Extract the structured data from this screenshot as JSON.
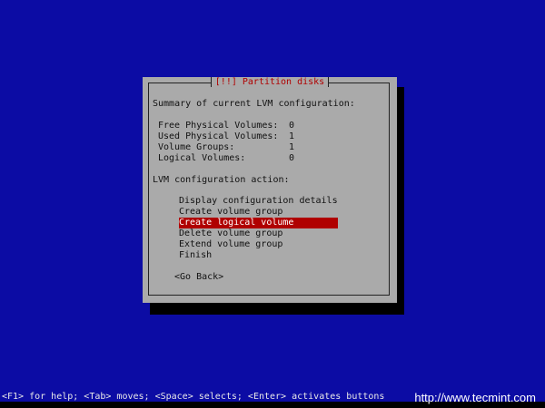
{
  "dialog": {
    "title": "[!!] Partition disks",
    "summary_heading": "Summary of current LVM configuration:",
    "summary": [
      {
        "label": "Free Physical Volumes:",
        "value": "0"
      },
      {
        "label": "Used Physical Volumes:",
        "value": "1"
      },
      {
        "label": "Volume Groups:",
        "value": "1"
      },
      {
        "label": "Logical Volumes:",
        "value": "0"
      }
    ],
    "action_heading": "LVM configuration action:",
    "actions": [
      "Display configuration details",
      "Create volume group",
      "Create logical volume",
      "Delete volume group",
      "Extend volume group",
      "Finish"
    ],
    "selected_index": 2,
    "go_back": "<Go Back>"
  },
  "status_bar": "<F1> for help; <Tab> moves; <Space> selects; <Enter> activates buttons",
  "watermark": "http://www.tecmint.com",
  "colors": {
    "background": "#0c0ca4",
    "dialog": "#aaaaaa",
    "highlight": "#b00000",
    "title": "#b00000"
  }
}
